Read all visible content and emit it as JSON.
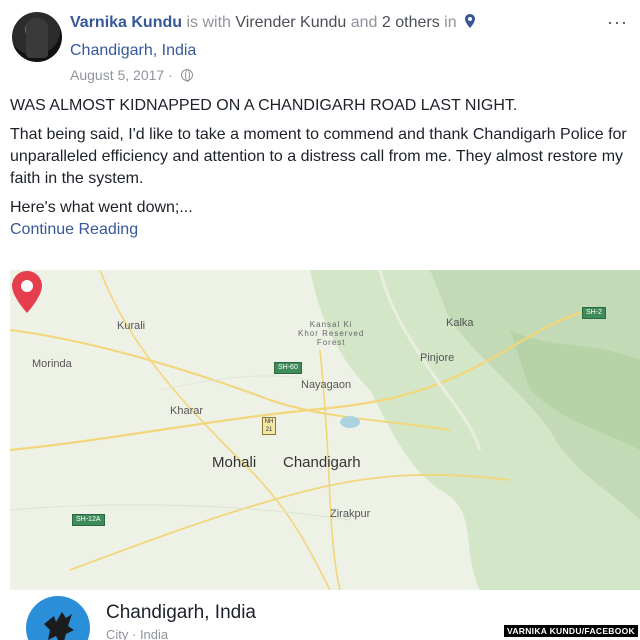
{
  "header": {
    "author": "Varnika Kundu",
    "is_with": "is with",
    "tagged": "Virender Kundu",
    "and_others": "and 2 others",
    "in": "in",
    "location": "Chandigarh, India",
    "date": "August 5, 2017 ·",
    "more_icon": "more-icon"
  },
  "post": {
    "headline": "WAS ALMOST KIDNAPPED ON A CHANDIGARH ROAD LAST NIGHT.",
    "paragraph": "That being said, I'd like to take a moment to commend and thank Chandigarh Police for unparalleled efficiency and attention to a distress call from me. They almost restore my faith in the system.",
    "lead_in": "Here's what went down;...",
    "continue": "Continue Reading"
  },
  "map": {
    "labels": {
      "kurali": "Kurali",
      "morinda": "Morinda",
      "kharar": "Kharar",
      "mohali": "Mohali",
      "chandigarh": "Chandigarh",
      "kalka": "Kalka",
      "pinjore": "Pinjore",
      "nayagaon": "Nayagaon",
      "zirakpur": "Zirakpur",
      "kansal": "Kansal Ki\nKhor Reserved\nForest"
    },
    "badges": {
      "sh60": "SH-60",
      "sh2": "SH-2",
      "sh12a": "SH-12A",
      "nh21": "NH\n21"
    },
    "colors": {
      "pin": "#e53e4c",
      "land": "#eef2e6",
      "hills": "#cfe2c4",
      "roads": "#f5d77e"
    }
  },
  "place": {
    "name": "Chandigarh, India",
    "sub": "City · India"
  },
  "credit": "VARNIKA KUNDU/FACEBOOK"
}
